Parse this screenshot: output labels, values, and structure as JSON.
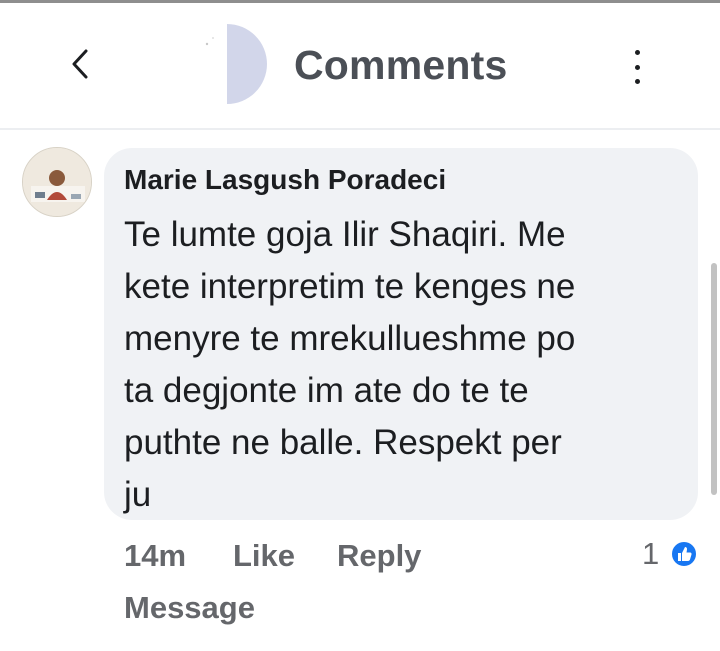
{
  "header": {
    "title": "Comments",
    "back_icon": "chevron-left-icon",
    "more_icon": "vertical-ellipsis-icon"
  },
  "comment": {
    "author": "Marie Lasgush Poradeci",
    "lines": [
      "Te lumtë goja Ilir Shaqiri. Me",
      "kete interpretim te kenges ne",
      "menyre te mrekullueshme po",
      "ta degjonte im ate do te te",
      "puthte ne balle. Respekt per",
      "ju"
    ],
    "text": "Te lumte goja Ilir Shaqiri. Me\nkete interpretim te kenges ne\nmenyre te mrekullueshme po\nta degjonte im ate do te te\nputhte ne balle. Respekt per\nju",
    "timestamp": "14m",
    "like_label": "Like",
    "reply_label": "Reply",
    "message_label": "Message",
    "reaction_count": "1",
    "reaction_icon": "thumbs-up-icon"
  },
  "colors": {
    "bubble": "#f0f2f5",
    "action_text": "#65676b",
    "primary_text": "#1c1e21",
    "like_blue": "#1877f2",
    "header_avatar": "#d2d6ea"
  }
}
